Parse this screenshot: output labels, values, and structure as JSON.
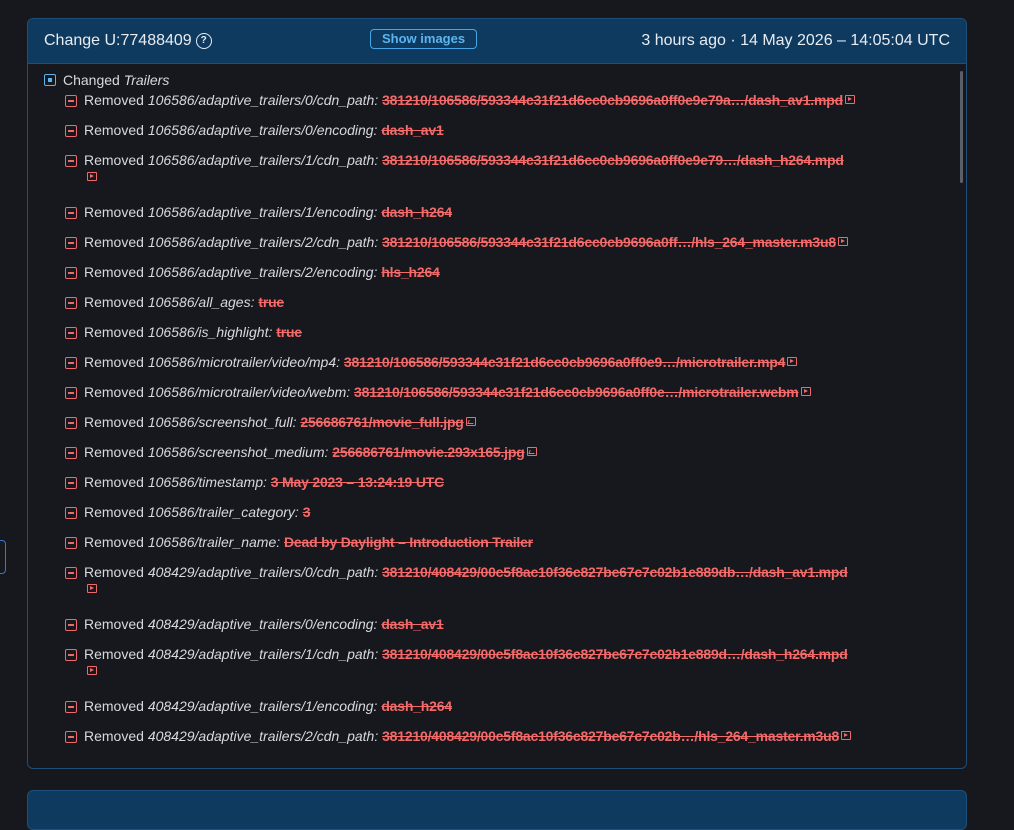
{
  "change": {
    "title": "Change U:77488409",
    "show_images_label": "Show images",
    "timestamp": "3 hours ago · 14 May 2026 – 14:05:04 UTC"
  },
  "group": {
    "verb": "Changed",
    "name": "Trailers"
  },
  "rows": [
    {
      "verb": "Removed",
      "path": "106586/adaptive_trailers/0/cdn_path:",
      "value": "381210/106586/593344c31f21d6cc0cb9696a0ff0e9e79a…/dash_av1.mpd",
      "icon": "video",
      "wrap": false
    },
    {
      "verb": "Removed",
      "path": "106586/adaptive_trailers/0/encoding:",
      "value": "dash_av1",
      "icon": "",
      "wrap": false
    },
    {
      "verb": "Removed",
      "path": "106586/adaptive_trailers/1/cdn_path:",
      "value": "381210/106586/593344c31f21d6cc0cb9696a0ff0e9e79…/dash_h264.mpd",
      "icon": "video",
      "wrap": true
    },
    {
      "verb": "Removed",
      "path": "106586/adaptive_trailers/1/encoding:",
      "value": "dash_h264",
      "icon": "",
      "wrap": false
    },
    {
      "verb": "Removed",
      "path": "106586/adaptive_trailers/2/cdn_path:",
      "value": "381210/106586/593344c31f21d6cc0cb9696a0ff…/hls_264_master.m3u8",
      "icon": "video",
      "wrap": false
    },
    {
      "verb": "Removed",
      "path": "106586/adaptive_trailers/2/encoding:",
      "value": "hls_h264",
      "icon": "",
      "wrap": false
    },
    {
      "verb": "Removed",
      "path": "106586/all_ages:",
      "value": "true",
      "icon": "",
      "wrap": false
    },
    {
      "verb": "Removed",
      "path": "106586/is_highlight:",
      "value": "true",
      "icon": "",
      "wrap": false
    },
    {
      "verb": "Removed",
      "path": "106586/microtrailer/video/mp4:",
      "value": "381210/106586/593344c31f21d6cc0cb9696a0ff0e9…/microtrailer.mp4",
      "icon": "video",
      "wrap": false
    },
    {
      "verb": "Removed",
      "path": "106586/microtrailer/video/webm:",
      "value": "381210/106586/593344c31f21d6cc0cb9696a0ff0e…/microtrailer.webm",
      "icon": "video",
      "wrap": false
    },
    {
      "verb": "Removed",
      "path": "106586/screenshot_full:",
      "value": "256686761/movie_full.jpg",
      "icon": "image",
      "wrap": false
    },
    {
      "verb": "Removed",
      "path": "106586/screenshot_medium:",
      "value": "256686761/movie.293x165.jpg",
      "icon": "image",
      "wrap": false
    },
    {
      "verb": "Removed",
      "path": "106586/timestamp:",
      "value": "3 May 2023 – 13:24:19 UTC",
      "icon": "",
      "wrap": false
    },
    {
      "verb": "Removed",
      "path": "106586/trailer_category:",
      "value": "3",
      "icon": "",
      "wrap": false
    },
    {
      "verb": "Removed",
      "path": "106586/trailer_name:",
      "value": "Dead by Daylight – Introduction Trailer",
      "icon": "",
      "wrap": false
    },
    {
      "verb": "Removed",
      "path": "408429/adaptive_trailers/0/cdn_path:",
      "value": "381210/408429/00c5f8ac10f36c827be67c7c02b1e889db…/dash_av1.mpd",
      "icon": "video",
      "wrap": true
    },
    {
      "verb": "Removed",
      "path": "408429/adaptive_trailers/0/encoding:",
      "value": "dash_av1",
      "icon": "",
      "wrap": false
    },
    {
      "verb": "Removed",
      "path": "408429/adaptive_trailers/1/cdn_path:",
      "value": "381210/408429/00c5f8ac10f36c827be67c7c02b1e889d…/dash_h264.mpd",
      "icon": "video",
      "wrap": true
    },
    {
      "verb": "Removed",
      "path": "408429/adaptive_trailers/1/encoding:",
      "value": "dash_h264",
      "icon": "",
      "wrap": false
    },
    {
      "verb": "Removed",
      "path": "408429/adaptive_trailers/2/cdn_path:",
      "value": "381210/408429/00c5f8ac10f36c827be67c7c02b…/hls_264_master.m3u8",
      "icon": "video",
      "wrap": false
    }
  ]
}
